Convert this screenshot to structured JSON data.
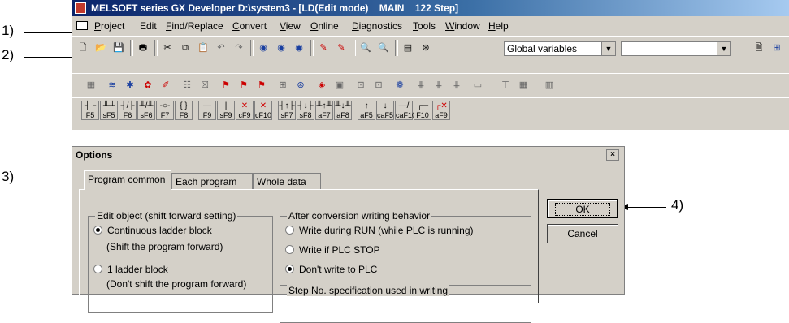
{
  "callouts": {
    "c1": "1)",
    "c2": "2)",
    "c3": "3)",
    "c4": "4)"
  },
  "app": {
    "title": "MELSOFT series GX Developer D:\\system3 - [LD(Edit mode)    MAIN    122 Step]",
    "menu": [
      {
        "label": "Project",
        "ul": "P"
      },
      {
        "label": "Edit",
        "ul": ""
      },
      {
        "label": "Find/Replace",
        "ul": "F"
      },
      {
        "label": "Convert",
        "ul": "C"
      },
      {
        "label": "View",
        "ul": "V"
      },
      {
        "label": "Online",
        "ul": "O"
      },
      {
        "label": "Diagnostics",
        "ul": "D"
      },
      {
        "label": "Tools",
        "ul": "T"
      },
      {
        "label": "Window",
        "ul": "W"
      },
      {
        "label": "Help",
        "ul": "H"
      }
    ],
    "global_vars_combo": "Global variables",
    "second_combo": "",
    "fkeys": [
      "F5",
      "sF5",
      "F6",
      "sF6",
      "F7",
      "F8",
      "F9",
      "sF9",
      "cF9",
      "cF10",
      "sF7",
      "sF8",
      "aF7",
      "aF8",
      "aF5",
      "caF5",
      "caF10",
      "F10",
      "aF9"
    ]
  },
  "dialog": {
    "title": "Options",
    "close_symbol": "×",
    "tabs": [
      "Program common",
      "Each program",
      "Whole data"
    ],
    "edit_object": {
      "legend": "Edit object (shift forward setting)",
      "opt1": "Continuous ladder block",
      "opt1_note": "(Shift the program forward)",
      "opt2": "1 ladder block",
      "opt2_note": "(Don't shift the program forward)"
    },
    "after_conversion": {
      "legend": "After conversion writing behavior",
      "opt1": "Write during RUN (while PLC is running)",
      "opt2": "Write if PLC STOP",
      "opt3": "Don't write to PLC"
    },
    "step_no_legend": "Step No. specification used in writing",
    "ok_label": "OK",
    "cancel_label": "Cancel"
  }
}
